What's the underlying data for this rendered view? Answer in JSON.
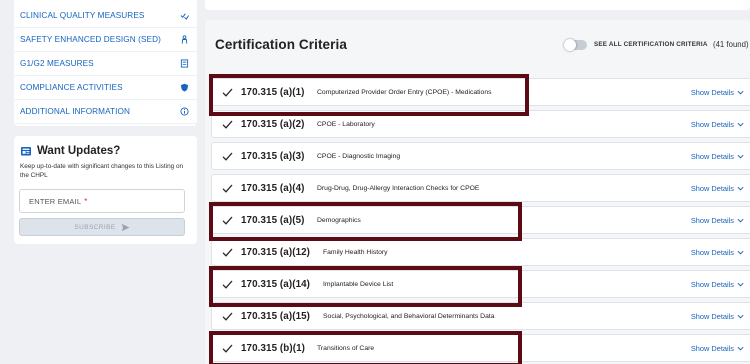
{
  "sidebar": {
    "items": [
      {
        "label": "CLINICAL QUALITY MEASURES",
        "icon": "checklist-icon"
      },
      {
        "label": "SAFETY ENHANCED DESIGN (SED)",
        "icon": "person-icon"
      },
      {
        "label": "G1/G2 MEASURES",
        "icon": "calculator-icon"
      },
      {
        "label": "COMPLIANCE ACTIVITIES",
        "icon": "shield-icon"
      },
      {
        "label": "ADDITIONAL INFORMATION",
        "icon": "info-icon"
      }
    ]
  },
  "updates": {
    "title": "Want Updates?",
    "text": "Keep up-to-date with significant changes to this Listing on the CHPL",
    "email_placeholder": "ENTER EMAIL",
    "required_mark": "*",
    "subscribe_label": "SUBSCRIBE"
  },
  "criteria": {
    "title": "Certification Criteria",
    "toggle_label": "SEE ALL CERTIFICATION CRITERIA",
    "toggle_on": false,
    "found_count": "(41 found)",
    "details_label": "Show Details",
    "rows": [
      {
        "number": "170.315 (a)(1)",
        "description": "Computerized Provider Order Entry (CPOE) - Medications",
        "highlighted": true
      },
      {
        "number": "170.315 (a)(2)",
        "description": "CPOE - Laboratory",
        "highlighted": false
      },
      {
        "number": "170.315 (a)(3)",
        "description": "CPOE - Diagnostic Imaging",
        "highlighted": false
      },
      {
        "number": "170.315 (a)(4)",
        "description": "Drug-Drug, Drug-Allergy Interaction Checks for CPOE",
        "highlighted": false
      },
      {
        "number": "170.315 (a)(5)",
        "description": "Demographics",
        "highlighted": true
      },
      {
        "number": "170.315 (a)(12)",
        "description": "Family Health History",
        "highlighted": false
      },
      {
        "number": "170.315 (a)(14)",
        "description": "Implantable Device List",
        "highlighted": true
      },
      {
        "number": "170.315 (a)(15)",
        "description": "Social, Psychological, and Behavioral Determinants Data",
        "highlighted": false
      },
      {
        "number": "170.315 (b)(1)",
        "description": "Transitions of Care",
        "highlighted": true
      }
    ]
  },
  "colors": {
    "link_blue": "#1565c0",
    "highlight_box": "#5c0a13",
    "required_red": "#d32f2f"
  }
}
